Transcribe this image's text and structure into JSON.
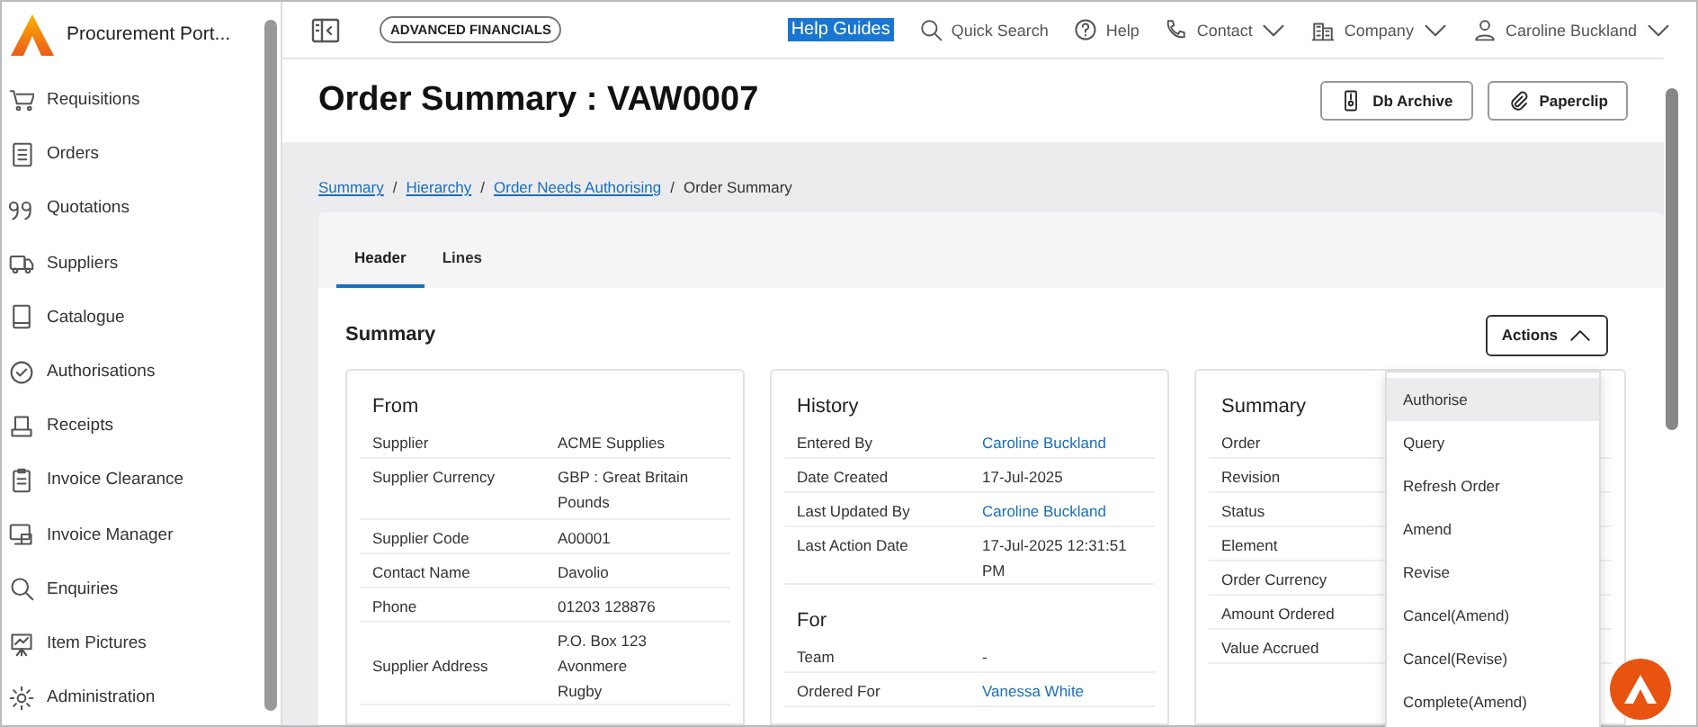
{
  "sidebar": {
    "app_title": "Procurement Port...",
    "items": [
      {
        "label": "Requisitions"
      },
      {
        "label": "Orders"
      },
      {
        "label": "Quotations"
      },
      {
        "label": "Suppliers"
      },
      {
        "label": "Catalogue"
      },
      {
        "label": "Authorisations"
      },
      {
        "label": "Receipts"
      },
      {
        "label": "Invoice Clearance"
      },
      {
        "label": "Invoice Manager"
      },
      {
        "label": "Enquiries"
      },
      {
        "label": "Item Pictures"
      },
      {
        "label": "Administration"
      }
    ]
  },
  "topbar": {
    "company_badge": "ADVANCED FINANCIALS",
    "help_guides": "Help Guides",
    "quick_search": "Quick Search",
    "help": "Help",
    "contact": "Contact",
    "company": "Company",
    "user": "Caroline Buckland"
  },
  "page": {
    "title": "Order Summary : VAW0007",
    "buttons": [
      {
        "label": "Db Archive"
      },
      {
        "label": "Paperclip"
      }
    ]
  },
  "breadcrumb": [
    {
      "kind": "link",
      "label": "Summary"
    },
    {
      "kind": "separator",
      "label": "/"
    },
    {
      "kind": "link",
      "label": "Hierarchy"
    },
    {
      "kind": "separator",
      "label": "/"
    },
    {
      "kind": "link",
      "label": "Order Needs Authorising"
    },
    {
      "kind": "separator",
      "label": "/"
    },
    {
      "kind": "current",
      "label": "Order Summary"
    }
  ],
  "tabs": [
    {
      "label": "Header",
      "selected": true
    },
    {
      "label": "Lines",
      "selected": false
    }
  ],
  "section_title": "Summary",
  "actions": {
    "label": "Actions",
    "expanded": true,
    "items": [
      {
        "label": "Authorise",
        "selected": true
      },
      {
        "label": "Query",
        "selected": false
      },
      {
        "label": "Refresh Order",
        "selected": false
      },
      {
        "label": "Amend",
        "selected": false
      },
      {
        "label": "Revise",
        "selected": false
      },
      {
        "label": "Cancel(Amend)",
        "selected": false
      },
      {
        "label": "Cancel(Revise)",
        "selected": false
      },
      {
        "label": "Complete(Amend)",
        "selected": false
      }
    ]
  },
  "cards": [
    {
      "groups": [
        {
          "title": "From",
          "rows": [
            {
              "label": "Supplier",
              "value": "ACME Supplies"
            },
            {
              "label": "Supplier Currency",
              "value": "GBP : Great Britain Pounds"
            },
            {
              "label": "Supplier Code",
              "value": "A00001"
            },
            {
              "label": "Contact Name",
              "value": "Davolio"
            },
            {
              "label": "Phone",
              "value": "01203 128876"
            },
            {
              "label": "Supplier Address",
              "lines": [
                "P.O. Box 123",
                "Avonmere",
                "Rugby"
              ]
            }
          ]
        }
      ]
    },
    {
      "groups": [
        {
          "title": "History",
          "rows": [
            {
              "label": "Entered By",
              "value": "Caroline Buckland",
              "link": true
            },
            {
              "label": "Date Created",
              "value": "17-Jul-2025"
            },
            {
              "label": "Last Updated By",
              "value": "Caroline Buckland",
              "link": true
            },
            {
              "label": "Last Action Date",
              "value": "17-Jul-2025 12:31:51 PM"
            }
          ]
        },
        {
          "title": "For",
          "rows": [
            {
              "label": "Team",
              "value": "-"
            },
            {
              "label": "Ordered For",
              "value": "Vanessa White",
              "link": true
            }
          ]
        }
      ]
    },
    {
      "groups": [
        {
          "title": "Summary",
          "rows": [
            {
              "label": "Order"
            },
            {
              "label": "Revision"
            },
            {
              "label": "Status"
            },
            {
              "label": "Element"
            },
            {
              "label": "Order Currency"
            },
            {
              "label": "Amount Ordered"
            },
            {
              "label": "Value Accrued"
            }
          ]
        }
      ]
    }
  ]
}
